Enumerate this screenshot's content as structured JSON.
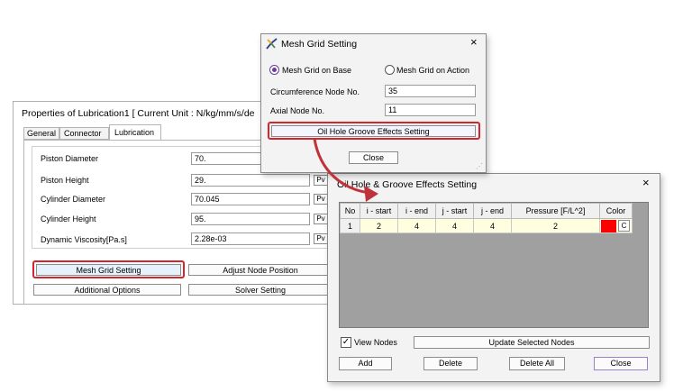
{
  "props": {
    "title": "Properties of Lubrication1 [ Current Unit : N/kg/mm/s/de",
    "tabs": [
      "General",
      "Connector",
      "Lubrication"
    ],
    "fields": [
      {
        "label": "Piston Diameter",
        "value": "70."
      },
      {
        "label": "Piston Height",
        "value": "29."
      },
      {
        "label": "Cylinder Diameter",
        "value": "70.045"
      },
      {
        "label": "Cylinder Height",
        "value": "95."
      },
      {
        "label": "Dynamic Viscosity[Pa.s]",
        "value": "2.28e-03"
      }
    ],
    "pv_label": "Pv",
    "mesh_grid_btn": "Mesh Grid Setting",
    "adjust_node_btn": "Adjust Node Position",
    "additional_btn": "Additional Options",
    "solver_btn": "Solver Setting"
  },
  "mesh": {
    "title": "Mesh Grid Setting",
    "close_x": "×",
    "radio_base": "Mesh Grid on Base",
    "radio_action": "Mesh Grid on Action",
    "selected": "base",
    "circ_label": "Circumference Node No.",
    "circ_value": "35",
    "axial_label": "Axial Node No.",
    "axial_value": "11",
    "oil_btn": "Oil Hole  Groove Effects Setting",
    "close_btn": "Close"
  },
  "oil": {
    "title": "Oil Hole & Groove Effects Setting",
    "close_x": "×",
    "columns": [
      "No",
      "i - start",
      "i - end",
      "j - start",
      "j - end",
      "Pressure [F/L^2]",
      "Color"
    ],
    "rows": [
      {
        "no": "1",
        "i_start": "2",
        "i_end": "4",
        "j_start": "4",
        "j_end": "4",
        "pressure": "2",
        "color": "#ff0000",
        "color_btn": "C"
      }
    ],
    "view_nodes": "View Nodes",
    "view_nodes_checked": true,
    "update_btn": "Update Selected Nodes",
    "add_btn": "Add",
    "delete_btn": "Delete",
    "delete_all_btn": "Delete All",
    "close_btn": "Close"
  },
  "colors": {
    "highlight": "#d4242e",
    "arrow": "#c0323a",
    "grid_bg": "#a0a0a0",
    "radio_accent": "#6a3d9a"
  }
}
